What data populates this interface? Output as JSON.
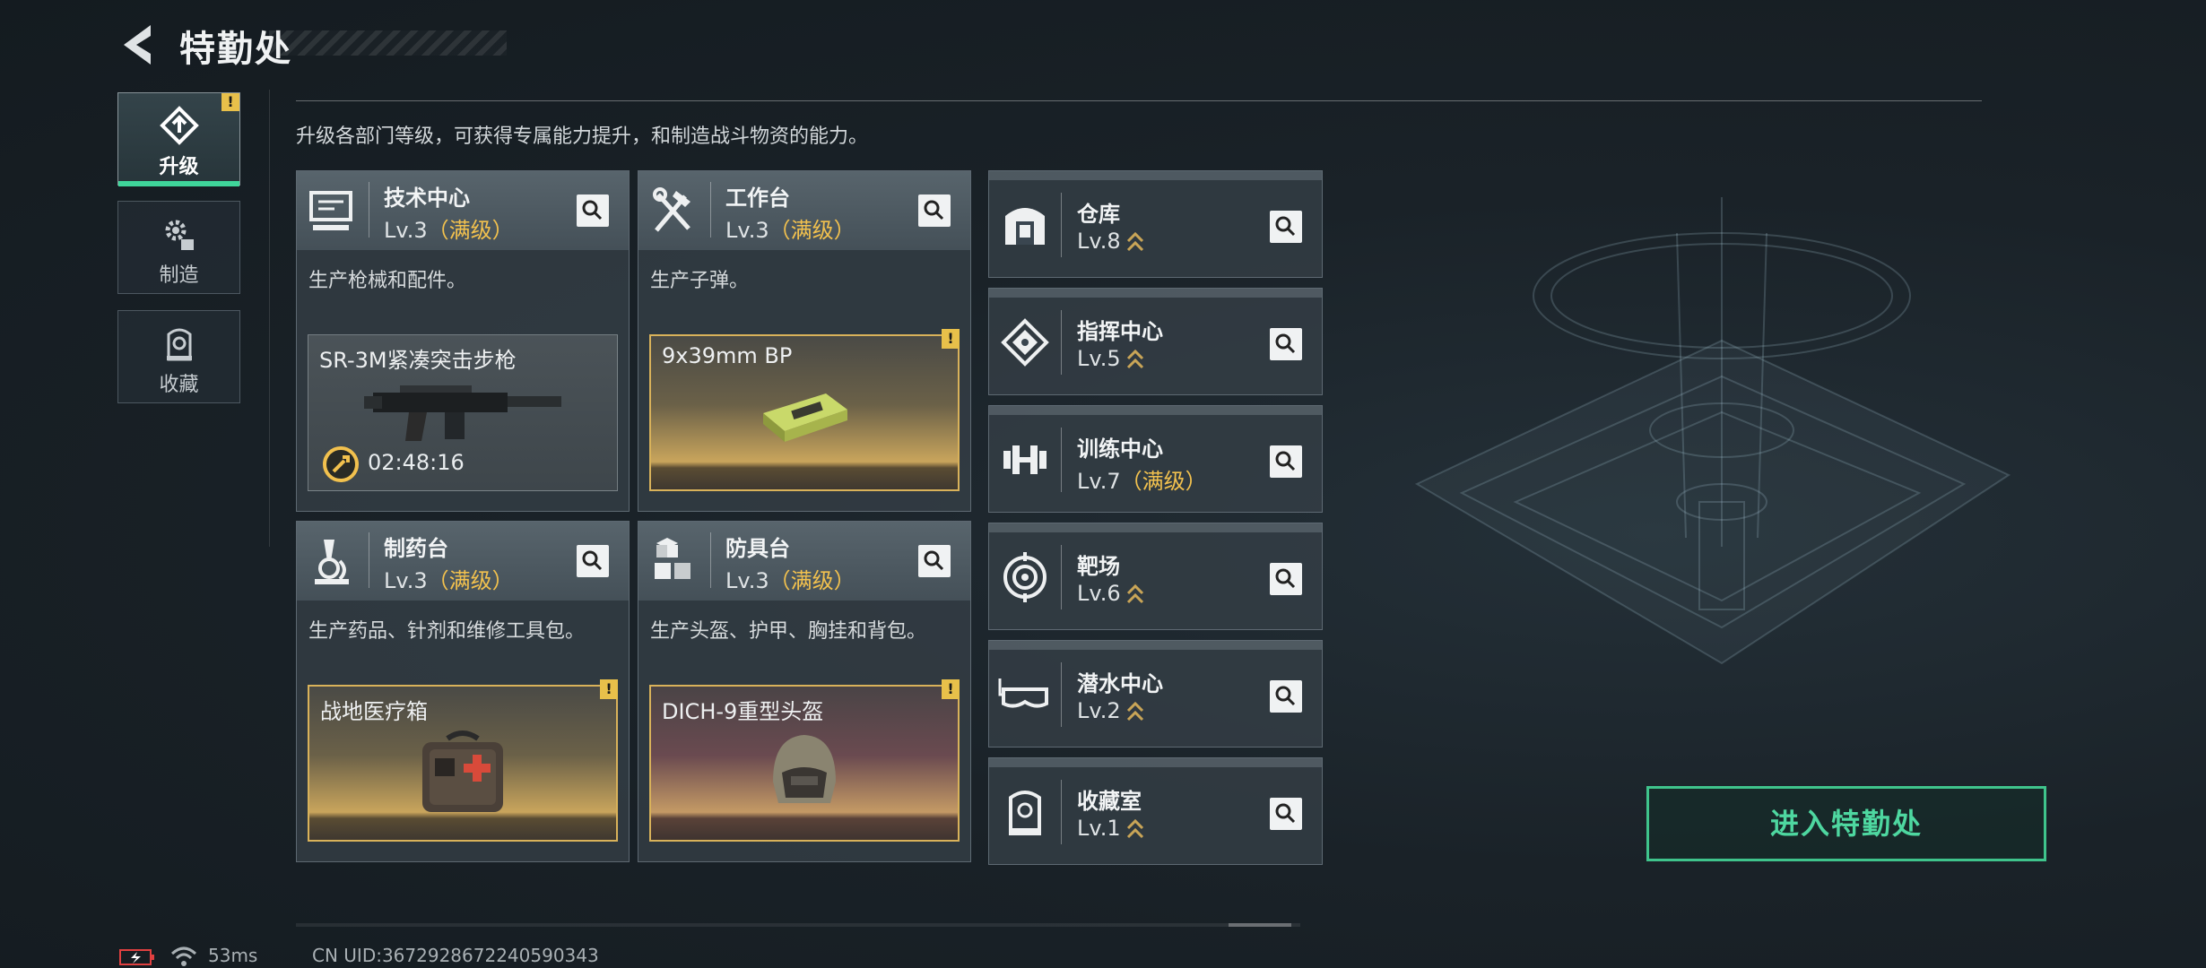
{
  "header": {
    "title": "特勤处"
  },
  "tabs": [
    {
      "label": "升级",
      "icon": "upgrade-icon",
      "active": true,
      "warning": "!"
    },
    {
      "label": "制造",
      "icon": "gears-icon",
      "active": false
    },
    {
      "label": "收藏",
      "icon": "trophy-case-icon",
      "active": false
    }
  ],
  "description": "升级各部门等级，可获得专属能力提升，和制造战斗物资的能力。",
  "departments": [
    {
      "name": "技术中心",
      "level": "Lv.3",
      "max": "（满级）",
      "desc": "生产枪械和配件。",
      "product": {
        "name": "SR-3M紧凑突击步枪",
        "timer": "02:48:16",
        "warning": ""
      }
    },
    {
      "name": "工作台",
      "level": "Lv.3",
      "max": "（满级）",
      "desc": "生产子弹。",
      "product": {
        "name": "9x39mm BP",
        "warning": "!"
      }
    },
    {
      "name": "制药台",
      "level": "Lv.3",
      "max": "（满级）",
      "desc": "生产药品、针剂和维修工具包。",
      "product": {
        "name": "战地医疗箱",
        "warning": "!"
      }
    },
    {
      "name": "防具台",
      "level": "Lv.3",
      "max": "（满级）",
      "desc": "生产头盔、护甲、胸挂和背包。",
      "product": {
        "name": "DICH-9重型头盔",
        "warning": "!"
      }
    }
  ],
  "facilities": [
    {
      "name": "仓库",
      "level": "Lv.8",
      "max": "",
      "icon": "vault-icon"
    },
    {
      "name": "指挥中心",
      "level": "Lv.5",
      "max": "",
      "icon": "chip-icon"
    },
    {
      "name": "训练中心",
      "level": "Lv.7",
      "max": "（满级）",
      "icon": "dumbbell-icon"
    },
    {
      "name": "靶场",
      "level": "Lv.6",
      "max": "",
      "icon": "target-icon"
    },
    {
      "name": "潜水中心",
      "level": "Lv.2",
      "max": "",
      "icon": "diving-mask-icon"
    },
    {
      "name": "收藏室",
      "level": "Lv.1",
      "max": "",
      "icon": "trophy-case-icon"
    }
  ],
  "enter_button": "进入特勤处",
  "status": {
    "latency": "53ms",
    "uid": "CN UID:3672928672240590343"
  },
  "colors": {
    "accent_green": "#3fc48c",
    "gold": "#f2c14e",
    "warning": "#e8c04a"
  }
}
